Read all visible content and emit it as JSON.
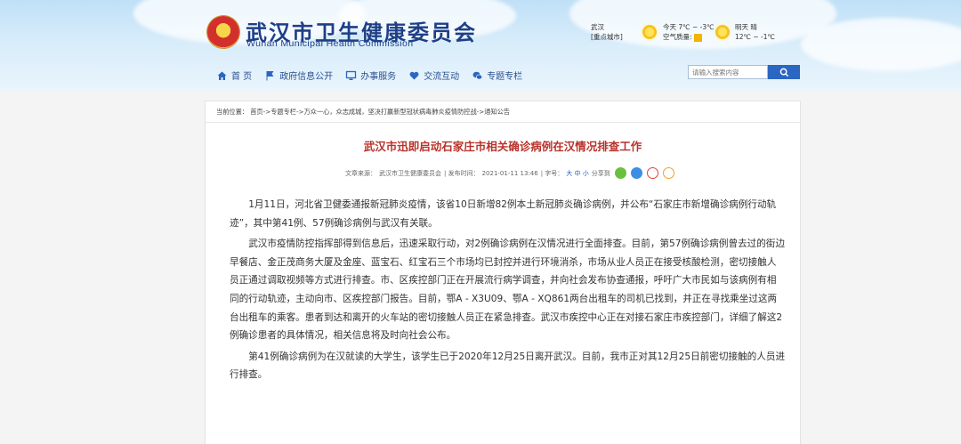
{
  "header": {
    "title": "武汉市卫生健康委员会",
    "subtitle": "Wuhan Municipal Health Commission",
    "weather": {
      "city": "武汉",
      "city_note": "[重点城市]",
      "today": "今天 7℃ ~ -3℃",
      "aq_label": "空气质量:",
      "tomorrow": "明天 晴",
      "tomorrow_temp": "12℃ ~ -1℃"
    },
    "nav": [
      {
        "label": "首 页",
        "icon": "home-icon"
      },
      {
        "label": "政府信息公开",
        "icon": "flag-icon"
      },
      {
        "label": "办事服务",
        "icon": "monitor-icon"
      },
      {
        "label": "交流互动",
        "icon": "heart-icon"
      },
      {
        "label": "专题专栏",
        "icon": "chat-icon"
      }
    ],
    "search": {
      "placeholder": "请输入搜索内容",
      "button": "Q"
    }
  },
  "breadcrumb": "当前位置：  首页->专题专栏->万众一心，众志成城，坚决打赢新型冠状病毒肺炎疫情防控战->通知公告",
  "article": {
    "title": "武汉市迅即启动石家庄市相关确诊病例在汉情况排查工作",
    "meta_source_label": "文章来源：",
    "meta_source": "武汉市卫生健康委员会",
    "meta_date_label": "| 发布时间：",
    "meta_date": "2021-01-11 13:46",
    "meta_font_label": "| 字号：",
    "meta_font": "大 中 小",
    "meta_share": "分享到",
    "paragraphs": [
      "1月11日，河北省卫健委通报新冠肺炎疫情，该省10日新增82例本土新冠肺炎确诊病例，并公布“石家庄市新增确诊病例行动轨迹”，其中第41例、57例确诊病例与武汉有关联。",
      "武汉市疫情防控指挥部得到信息后，迅速采取行动，对2例确诊病例在汉情况进行全面排查。目前，第57例确诊病例曾去过的街边早餐店、金正茂商务大厦及金座、蓝宝石、红宝石三个市场均已封控并进行环境消杀，市场从业人员正在接受核酸检测，密切接触人员正通过调取视频等方式进行排查。市、区疾控部门正在开展流行病学调查，并向社会发布协查通报，呼吁广大市民如与该病例有相同的行动轨迹，主动向市、区疾控部门报告。目前，鄂A - X3U09、鄂A - XQ861两台出租车的司机已找到，并正在寻找乘坐过这两台出租车的乘客。患者到达和离开的火车站的密切接触人员正在紧急排查。武汉市疾控中心正在对接石家庄市疾控部门，详细了解这2例确诊患者的具体情况，相关信息将及时向社会公布。",
      "第41例确诊病例为在汉就读的大学生，该学生已于2020年12月25日离开武汉。目前，我市正对其12月25日前密切接触的人员进行排查。"
    ]
  },
  "colors": {
    "title_red": "#b8322a",
    "nav_blue": "#2a4f8f",
    "search_btn": "#2a66c2"
  }
}
